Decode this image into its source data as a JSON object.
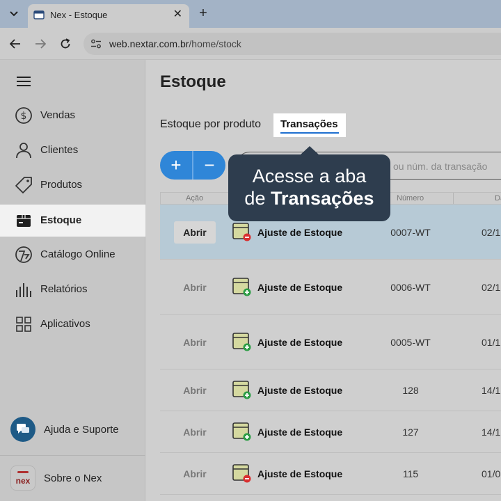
{
  "browser": {
    "tab_title": "Nex - Estoque",
    "url_host": "web.nextar.com.br",
    "url_path": "/home/stock"
  },
  "sidebar": {
    "items": [
      {
        "label": "Vendas",
        "icon": "dollar-circle-icon"
      },
      {
        "label": "Clientes",
        "icon": "person-icon"
      },
      {
        "label": "Produtos",
        "icon": "tag-icon"
      },
      {
        "label": "Estoque",
        "icon": "box-icon",
        "active": true
      },
      {
        "label": "Catálogo Online",
        "icon": "catalog-icon"
      },
      {
        "label": "Relatórios",
        "icon": "bar-chart-icon"
      },
      {
        "label": "Aplicativos",
        "icon": "grid-icon"
      }
    ],
    "help_label": "Ajuda e Suporte",
    "about_label": "Sobre o Nex",
    "logo_text": "nex"
  },
  "main": {
    "title": "Estoque",
    "tabs": [
      {
        "label": "Estoque por produto"
      },
      {
        "label": "Transações",
        "active": true
      }
    ],
    "add_label": "+",
    "remove_label": "−",
    "search_placeholder": "ou núm. da transação",
    "columns": [
      "Ação",
      "Número",
      "Dat"
    ],
    "rows": [
      {
        "action": "Abrir",
        "type": "Ajuste de Estoque",
        "number": "0007-WT",
        "date": "02/1",
        "sign": "minus",
        "selected": true
      },
      {
        "action": "Abrir",
        "type": "Ajuste de Estoque",
        "number": "0006-WT",
        "date": "02/1",
        "sign": "plus"
      },
      {
        "action": "Abrir",
        "type": "Ajuste de Estoque",
        "number": "0005-WT",
        "date": "01/1",
        "sign": "plus"
      },
      {
        "action": "Abrir",
        "type": "Ajuste de Estoque",
        "number": "128",
        "date": "14/1",
        "sign": "plus"
      },
      {
        "action": "Abrir",
        "type": "Ajuste de Estoque",
        "number": "127",
        "date": "14/1",
        "sign": "plus"
      },
      {
        "action": "Abrir",
        "type": "Ajuste de Estoque",
        "number": "115",
        "date": "01/0",
        "sign": "minus"
      }
    ],
    "colors": {
      "accent": "#2f86d8",
      "minus": "#d93030",
      "plus": "#2e9e46",
      "tooltip": "#2e3d4e"
    }
  },
  "tooltip": {
    "line1": "Acesse a aba",
    "line2_prefix": "de",
    "line2_bold": "Transações"
  }
}
